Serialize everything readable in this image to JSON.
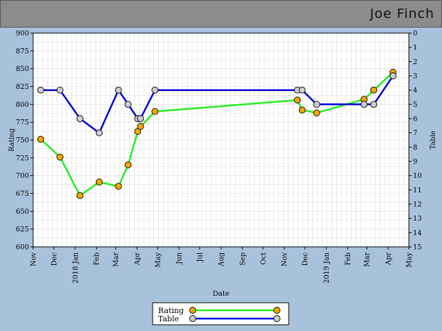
{
  "header": {
    "player_name": "Joe Finch"
  },
  "colors": {
    "header_bg": "#8c8c8c",
    "page_bg": "#a9c2dc",
    "plot_bg": "#ffffff",
    "grid": "#dcdcdc",
    "rating_line": "#22ee22",
    "rating_marker": "#f0a800",
    "table_line": "#0000dd",
    "table_marker": "#cccccc"
  },
  "chart_data": {
    "type": "line",
    "title": "",
    "xlabel": "Date",
    "ylabel": "Rating",
    "y2label": "Table",
    "grid": true,
    "legend_position": "bottom-center",
    "xlim": [
      "2017-11-01",
      "2019-05-01"
    ],
    "ylim": [
      600,
      900
    ],
    "y2lim": [
      0,
      15
    ],
    "y2_inverted": true,
    "y_ticks": [
      600,
      625,
      650,
      675,
      700,
      725,
      750,
      775,
      800,
      825,
      850,
      875,
      900
    ],
    "y2_ticks": [
      0,
      1,
      2,
      3,
      4,
      5,
      6,
      7,
      8,
      9,
      10,
      11,
      12,
      13,
      14,
      15
    ],
    "x_ticks": [
      {
        "date": "2017-11-01",
        "label": "Nov"
      },
      {
        "date": "2017-12-01",
        "label": "Dec"
      },
      {
        "date": "2018-01-01",
        "label": "2018 Jan"
      },
      {
        "date": "2018-02-01",
        "label": "Feb"
      },
      {
        "date": "2018-03-01",
        "label": "Mar"
      },
      {
        "date": "2018-04-01",
        "label": "Apr"
      },
      {
        "date": "2018-05-01",
        "label": "May"
      },
      {
        "date": "2018-06-01",
        "label": "Jun"
      },
      {
        "date": "2018-07-01",
        "label": "Jul"
      },
      {
        "date": "2018-08-01",
        "label": "Aug"
      },
      {
        "date": "2018-09-01",
        "label": "Sep"
      },
      {
        "date": "2018-10-01",
        "label": "Oct"
      },
      {
        "date": "2018-11-01",
        "label": "Nov"
      },
      {
        "date": "2018-12-01",
        "label": "Dec"
      },
      {
        "date": "2019-01-01",
        "label": "2019 Jan"
      },
      {
        "date": "2019-02-01",
        "label": "Feb"
      },
      {
        "date": "2019-03-01",
        "label": "Mar"
      },
      {
        "date": "2019-04-01",
        "label": "Apr"
      },
      {
        "date": "2019-05-01",
        "label": "May"
      }
    ],
    "series": [
      {
        "name": "Rating",
        "axis": "left",
        "points": [
          {
            "date": "2017-11-12",
            "value": 751
          },
          {
            "date": "2017-12-10",
            "value": 726
          },
          {
            "date": "2018-01-08",
            "value": 672
          },
          {
            "date": "2018-02-05",
            "value": 691
          },
          {
            "date": "2018-03-05",
            "value": 685
          },
          {
            "date": "2018-03-19",
            "value": 715
          },
          {
            "date": "2018-04-02",
            "value": 762
          },
          {
            "date": "2018-04-06",
            "value": 769
          },
          {
            "date": "2018-04-27",
            "value": 790
          },
          {
            "date": "2018-11-20",
            "value": 806
          },
          {
            "date": "2018-11-27",
            "value": 792
          },
          {
            "date": "2018-12-18",
            "value": 788
          },
          {
            "date": "2019-02-25",
            "value": 807
          },
          {
            "date": "2019-03-11",
            "value": 820
          },
          {
            "date": "2019-04-08",
            "value": 845
          }
        ]
      },
      {
        "name": "Table",
        "axis": "right",
        "points": [
          {
            "date": "2017-11-12",
            "value": 4
          },
          {
            "date": "2017-12-10",
            "value": 4
          },
          {
            "date": "2018-01-08",
            "value": 6
          },
          {
            "date": "2018-02-05",
            "value": 7
          },
          {
            "date": "2018-03-05",
            "value": 4
          },
          {
            "date": "2018-03-19",
            "value": 5
          },
          {
            "date": "2018-04-02",
            "value": 6
          },
          {
            "date": "2018-04-06",
            "value": 6
          },
          {
            "date": "2018-04-27",
            "value": 4
          },
          {
            "date": "2018-11-20",
            "value": 4
          },
          {
            "date": "2018-11-27",
            "value": 4
          },
          {
            "date": "2018-12-18",
            "value": 5
          },
          {
            "date": "2019-02-25",
            "value": 5
          },
          {
            "date": "2019-03-11",
            "value": 5
          },
          {
            "date": "2019-04-08",
            "value": 3
          }
        ]
      }
    ]
  }
}
